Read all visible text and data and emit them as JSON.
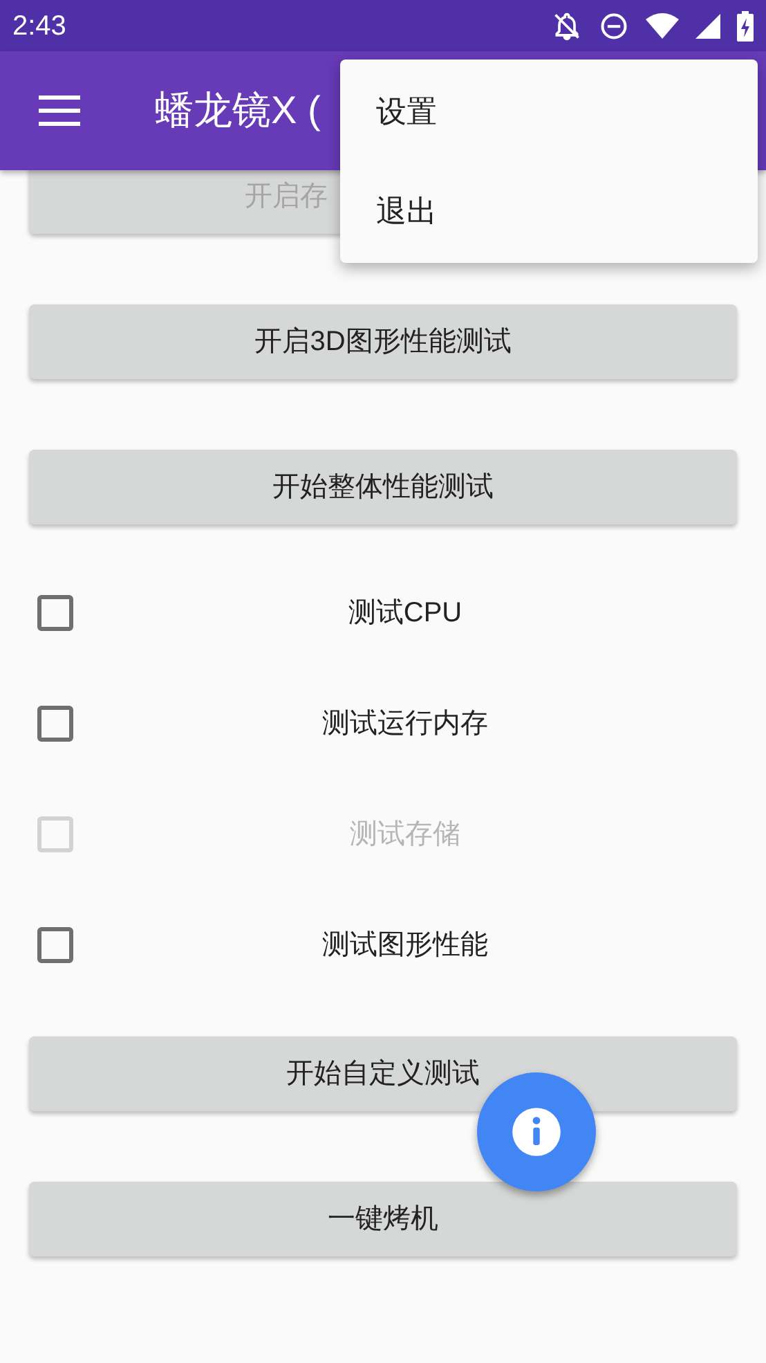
{
  "status_bar": {
    "time": "2:43"
  },
  "app_bar": {
    "title": "蟠龙镜X ("
  },
  "menu": {
    "items": [
      {
        "label": "设置"
      },
      {
        "label": "退出"
      }
    ]
  },
  "top_buttons": [
    {
      "label": "开启存",
      "disabled": true
    },
    {
      "label": "开启3D图形性能测试",
      "disabled": false
    },
    {
      "label": "开始整体性能测试",
      "disabled": false
    }
  ],
  "checkboxes": [
    {
      "label": "测试CPU",
      "checked": false,
      "disabled": false
    },
    {
      "label": "测试运行内存",
      "checked": false,
      "disabled": false
    },
    {
      "label": "测试存储",
      "checked": false,
      "disabled": true
    },
    {
      "label": "测试图形性能",
      "checked": false,
      "disabled": false
    }
  ],
  "bottom_buttons": [
    {
      "label": "开始自定义测试",
      "disabled": false
    },
    {
      "label": "一键烤机",
      "disabled": false
    }
  ]
}
